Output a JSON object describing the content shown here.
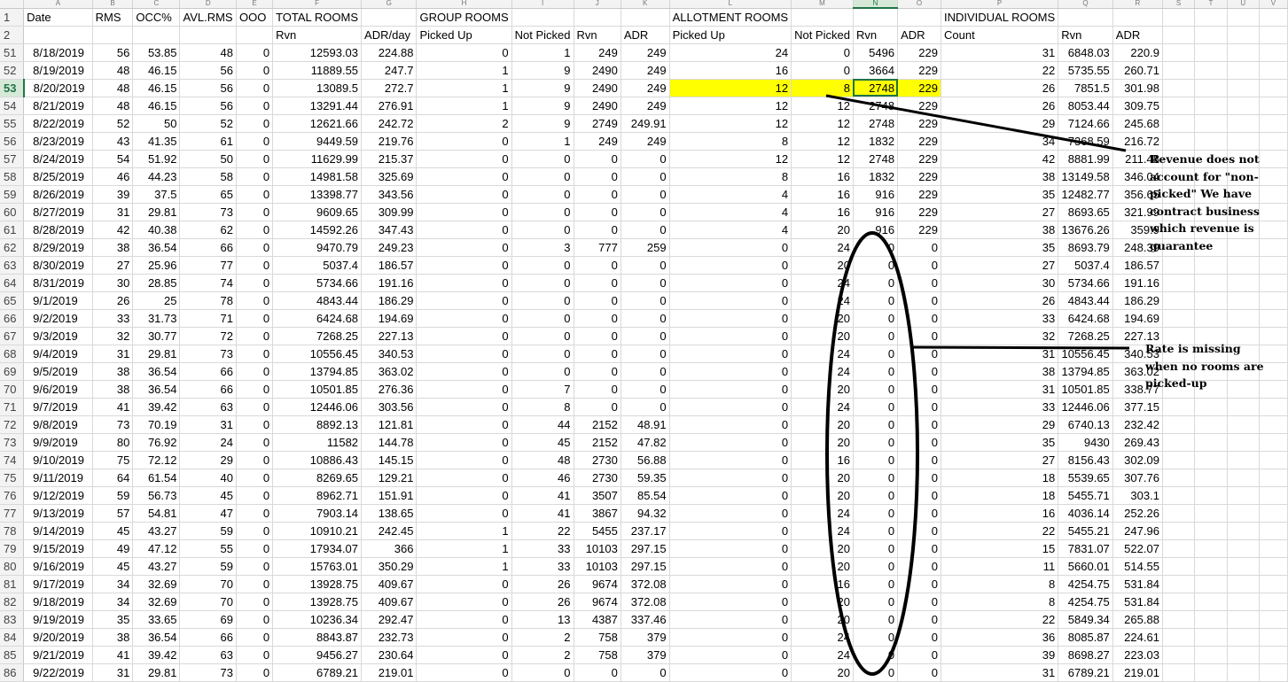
{
  "columns": [
    "A",
    "B",
    "C",
    "D",
    "E",
    "F",
    "G",
    "H",
    "I",
    "J",
    "K",
    "L",
    "M",
    "N",
    "O",
    "P",
    "Q",
    "R",
    "S",
    "T",
    "U",
    "V"
  ],
  "selected_column": "N",
  "selected_row": "53",
  "header_rows": [
    {
      "row": "1",
      "cells": [
        "Date",
        "RMS",
        "OCC%",
        "AVL.RMS",
        "OOO",
        "TOTAL ROOMS",
        "",
        "GROUP ROOMS",
        "",
        "",
        "",
        "ALLOTMENT ROOMS",
        "",
        "",
        "",
        "INDIVIDUAL ROOMS",
        "",
        "",
        "",
        "",
        "",
        ""
      ]
    },
    {
      "row": "2",
      "cells": [
        "",
        "",
        "",
        "",
        "",
        "Rvn",
        "ADR/day",
        "Picked Up",
        "Not Picked",
        "Rvn",
        "ADR",
        "Picked Up",
        "Not Picked",
        "Rvn",
        "ADR",
        "Count",
        "Rvn",
        "ADR",
        "",
        "",
        "",
        ""
      ]
    }
  ],
  "data_rows": [
    {
      "row": "51",
      "cells": [
        "8/18/2019",
        "56",
        "53.85",
        "48",
        "0",
        "12593.03",
        "224.88",
        "0",
        "1",
        "249",
        "249",
        "24",
        "0",
        "5496",
        "229",
        "31",
        "6848.03",
        "220.9"
      ]
    },
    {
      "row": "52",
      "cells": [
        "8/19/2019",
        "48",
        "46.15",
        "56",
        "0",
        "11889.55",
        "247.7",
        "1",
        "9",
        "2490",
        "249",
        "16",
        "0",
        "3664",
        "229",
        "22",
        "5735.55",
        "260.71"
      ]
    },
    {
      "row": "53",
      "cells": [
        "8/20/2019",
        "48",
        "46.15",
        "56",
        "0",
        "13089.5",
        "272.7",
        "1",
        "9",
        "2490",
        "249",
        "12",
        "8",
        "2748",
        "229",
        "26",
        "7851.5",
        "301.98"
      ]
    },
    {
      "row": "54",
      "cells": [
        "8/21/2019",
        "48",
        "46.15",
        "56",
        "0",
        "13291.44",
        "276.91",
        "1",
        "9",
        "2490",
        "249",
        "12",
        "12",
        "2748",
        "229",
        "26",
        "8053.44",
        "309.75"
      ]
    },
    {
      "row": "55",
      "cells": [
        "8/22/2019",
        "52",
        "50",
        "52",
        "0",
        "12621.66",
        "242.72",
        "2",
        "9",
        "2749",
        "249.91",
        "12",
        "12",
        "2748",
        "229",
        "29",
        "7124.66",
        "245.68"
      ]
    },
    {
      "row": "56",
      "cells": [
        "8/23/2019",
        "43",
        "41.35",
        "61",
        "0",
        "9449.59",
        "219.76",
        "0",
        "1",
        "249",
        "249",
        "8",
        "12",
        "1832",
        "229",
        "34",
        "7368.59",
        "216.72"
      ]
    },
    {
      "row": "57",
      "cells": [
        "8/24/2019",
        "54",
        "51.92",
        "50",
        "0",
        "11629.99",
        "215.37",
        "0",
        "0",
        "0",
        "0",
        "12",
        "12",
        "2748",
        "229",
        "42",
        "8881.99",
        "211.48"
      ]
    },
    {
      "row": "58",
      "cells": [
        "8/25/2019",
        "46",
        "44.23",
        "58",
        "0",
        "14981.58",
        "325.69",
        "0",
        "0",
        "0",
        "0",
        "8",
        "16",
        "1832",
        "229",
        "38",
        "13149.58",
        "346.04"
      ]
    },
    {
      "row": "59",
      "cells": [
        "8/26/2019",
        "39",
        "37.5",
        "65",
        "0",
        "13398.77",
        "343.56",
        "0",
        "0",
        "0",
        "0",
        "4",
        "16",
        "916",
        "229",
        "35",
        "12482.77",
        "356.65"
      ]
    },
    {
      "row": "60",
      "cells": [
        "8/27/2019",
        "31",
        "29.81",
        "73",
        "0",
        "9609.65",
        "309.99",
        "0",
        "0",
        "0",
        "0",
        "4",
        "16",
        "916",
        "229",
        "27",
        "8693.65",
        "321.99"
      ]
    },
    {
      "row": "61",
      "cells": [
        "8/28/2019",
        "42",
        "40.38",
        "62",
        "0",
        "14592.26",
        "347.43",
        "0",
        "0",
        "0",
        "0",
        "4",
        "20",
        "916",
        "229",
        "38",
        "13676.26",
        "359.9"
      ]
    },
    {
      "row": "62",
      "cells": [
        "8/29/2019",
        "38",
        "36.54",
        "66",
        "0",
        "9470.79",
        "249.23",
        "0",
        "3",
        "777",
        "259",
        "0",
        "24",
        "0",
        "0",
        "35",
        "8693.79",
        "248.39"
      ]
    },
    {
      "row": "63",
      "cells": [
        "8/30/2019",
        "27",
        "25.96",
        "77",
        "0",
        "5037.4",
        "186.57",
        "0",
        "0",
        "0",
        "0",
        "0",
        "20",
        "0",
        "0",
        "27",
        "5037.4",
        "186.57"
      ]
    },
    {
      "row": "64",
      "cells": [
        "8/31/2019",
        "30",
        "28.85",
        "74",
        "0",
        "5734.66",
        "191.16",
        "0",
        "0",
        "0",
        "0",
        "0",
        "24",
        "0",
        "0",
        "30",
        "5734.66",
        "191.16"
      ]
    },
    {
      "row": "65",
      "cells": [
        "9/1/2019",
        "26",
        "25",
        "78",
        "0",
        "4843.44",
        "186.29",
        "0",
        "0",
        "0",
        "0",
        "0",
        "24",
        "0",
        "0",
        "26",
        "4843.44",
        "186.29"
      ]
    },
    {
      "row": "66",
      "cells": [
        "9/2/2019",
        "33",
        "31.73",
        "71",
        "0",
        "6424.68",
        "194.69",
        "0",
        "0",
        "0",
        "0",
        "0",
        "20",
        "0",
        "0",
        "33",
        "6424.68",
        "194.69"
      ]
    },
    {
      "row": "67",
      "cells": [
        "9/3/2019",
        "32",
        "30.77",
        "72",
        "0",
        "7268.25",
        "227.13",
        "0",
        "0",
        "0",
        "0",
        "0",
        "20",
        "0",
        "0",
        "32",
        "7268.25",
        "227.13"
      ]
    },
    {
      "row": "68",
      "cells": [
        "9/4/2019",
        "31",
        "29.81",
        "73",
        "0",
        "10556.45",
        "340.53",
        "0",
        "0",
        "0",
        "0",
        "0",
        "24",
        "0",
        "0",
        "31",
        "10556.45",
        "340.53"
      ]
    },
    {
      "row": "69",
      "cells": [
        "9/5/2019",
        "38",
        "36.54",
        "66",
        "0",
        "13794.85",
        "363.02",
        "0",
        "0",
        "0",
        "0",
        "0",
        "24",
        "0",
        "0",
        "38",
        "13794.85",
        "363.02"
      ]
    },
    {
      "row": "70",
      "cells": [
        "9/6/2019",
        "38",
        "36.54",
        "66",
        "0",
        "10501.85",
        "276.36",
        "0",
        "7",
        "0",
        "0",
        "0",
        "20",
        "0",
        "0",
        "31",
        "10501.85",
        "338.77"
      ]
    },
    {
      "row": "71",
      "cells": [
        "9/7/2019",
        "41",
        "39.42",
        "63",
        "0",
        "12446.06",
        "303.56",
        "0",
        "8",
        "0",
        "0",
        "0",
        "24",
        "0",
        "0",
        "33",
        "12446.06",
        "377.15"
      ]
    },
    {
      "row": "72",
      "cells": [
        "9/8/2019",
        "73",
        "70.19",
        "31",
        "0",
        "8892.13",
        "121.81",
        "0",
        "44",
        "2152",
        "48.91",
        "0",
        "20",
        "0",
        "0",
        "29",
        "6740.13",
        "232.42"
      ]
    },
    {
      "row": "73",
      "cells": [
        "9/9/2019",
        "80",
        "76.92",
        "24",
        "0",
        "11582",
        "144.78",
        "0",
        "45",
        "2152",
        "47.82",
        "0",
        "20",
        "0",
        "0",
        "35",
        "9430",
        "269.43"
      ]
    },
    {
      "row": "74",
      "cells": [
        "9/10/2019",
        "75",
        "72.12",
        "29",
        "0",
        "10886.43",
        "145.15",
        "0",
        "48",
        "2730",
        "56.88",
        "0",
        "16",
        "0",
        "0",
        "27",
        "8156.43",
        "302.09"
      ]
    },
    {
      "row": "75",
      "cells": [
        "9/11/2019",
        "64",
        "61.54",
        "40",
        "0",
        "8269.65",
        "129.21",
        "0",
        "46",
        "2730",
        "59.35",
        "0",
        "20",
        "0",
        "0",
        "18",
        "5539.65",
        "307.76"
      ]
    },
    {
      "row": "76",
      "cells": [
        "9/12/2019",
        "59",
        "56.73",
        "45",
        "0",
        "8962.71",
        "151.91",
        "0",
        "41",
        "3507",
        "85.54",
        "0",
        "20",
        "0",
        "0",
        "18",
        "5455.71",
        "303.1"
      ]
    },
    {
      "row": "77",
      "cells": [
        "9/13/2019",
        "57",
        "54.81",
        "47",
        "0",
        "7903.14",
        "138.65",
        "0",
        "41",
        "3867",
        "94.32",
        "0",
        "24",
        "0",
        "0",
        "16",
        "4036.14",
        "252.26"
      ]
    },
    {
      "row": "78",
      "cells": [
        "9/14/2019",
        "45",
        "43.27",
        "59",
        "0",
        "10910.21",
        "242.45",
        "1",
        "22",
        "5455",
        "237.17",
        "0",
        "24",
        "0",
        "0",
        "22",
        "5455.21",
        "247.96"
      ]
    },
    {
      "row": "79",
      "cells": [
        "9/15/2019",
        "49",
        "47.12",
        "55",
        "0",
        "17934.07",
        "366",
        "1",
        "33",
        "10103",
        "297.15",
        "0",
        "20",
        "0",
        "0",
        "15",
        "7831.07",
        "522.07"
      ]
    },
    {
      "row": "80",
      "cells": [
        "9/16/2019",
        "45",
        "43.27",
        "59",
        "0",
        "15763.01",
        "350.29",
        "1",
        "33",
        "10103",
        "297.15",
        "0",
        "20",
        "0",
        "0",
        "11",
        "5660.01",
        "514.55"
      ]
    },
    {
      "row": "81",
      "cells": [
        "9/17/2019",
        "34",
        "32.69",
        "70",
        "0",
        "13928.75",
        "409.67",
        "0",
        "26",
        "9674",
        "372.08",
        "0",
        "16",
        "0",
        "0",
        "8",
        "4254.75",
        "531.84"
      ]
    },
    {
      "row": "82",
      "cells": [
        "9/18/2019",
        "34",
        "32.69",
        "70",
        "0",
        "13928.75",
        "409.67",
        "0",
        "26",
        "9674",
        "372.08",
        "0",
        "20",
        "0",
        "0",
        "8",
        "4254.75",
        "531.84"
      ]
    },
    {
      "row": "83",
      "cells": [
        "9/19/2019",
        "35",
        "33.65",
        "69",
        "0",
        "10236.34",
        "292.47",
        "0",
        "13",
        "4387",
        "337.46",
        "0",
        "20",
        "0",
        "0",
        "22",
        "5849.34",
        "265.88"
      ]
    },
    {
      "row": "84",
      "cells": [
        "9/20/2019",
        "38",
        "36.54",
        "66",
        "0",
        "8843.87",
        "232.73",
        "0",
        "2",
        "758",
        "379",
        "0",
        "24",
        "0",
        "0",
        "36",
        "8085.87",
        "224.61"
      ]
    },
    {
      "row": "85",
      "cells": [
        "9/21/2019",
        "41",
        "39.42",
        "63",
        "0",
        "9456.27",
        "230.64",
        "0",
        "2",
        "758",
        "379",
        "0",
        "24",
        "0",
        "0",
        "39",
        "8698.27",
        "223.03"
      ]
    },
    {
      "row": "86",
      "cells": [
        "9/22/2019",
        "31",
        "29.81",
        "73",
        "0",
        "6789.21",
        "219.01",
        "0",
        "0",
        "0",
        "0",
        "0",
        "20",
        "0",
        "0",
        "31",
        "6789.21",
        "219.01"
      ]
    }
  ],
  "annotations": {
    "revenue_note": "Revenue does not account for \"non-picked\" We have contract business which revenue is guarantee",
    "rate_note": "Rate is missing when no rooms are picked-up"
  },
  "colors": {
    "highlight": "#ffff00",
    "selection": "#217346",
    "header_bg": "#f3f3f3",
    "gridline": "#d9d9d9"
  }
}
